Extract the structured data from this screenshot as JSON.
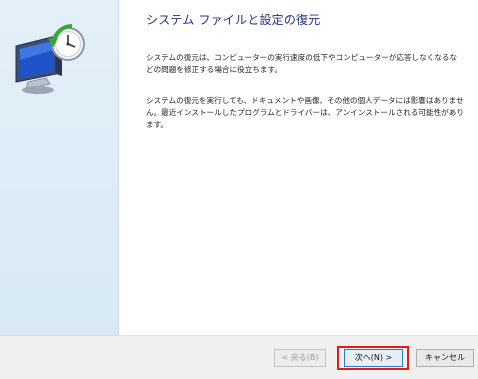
{
  "dialog": {
    "title": "システム ファイルと設定の復元",
    "paragraph1": "システムの復元は、コンピューターの実行速度の低下やコンピューターが応答しなくなるなどの問題を修正する場合に役立ちます。",
    "paragraph2": "システムの復元を実行しても、ドキュメントや画像、その他の個人データには影響はありません。最近インストールしたプログラムとドライバーは、アンインストールされる可能性があります。"
  },
  "buttons": {
    "back": "< 戻る(B)",
    "next": "次へ(N) >",
    "cancel": "キャンセル"
  },
  "icon": "system-restore-icon",
  "colors": {
    "title": "#1e3287",
    "left_panel": "#dcebf6",
    "highlight": "#e21a1a",
    "default_button_border": "#2a78d4"
  }
}
